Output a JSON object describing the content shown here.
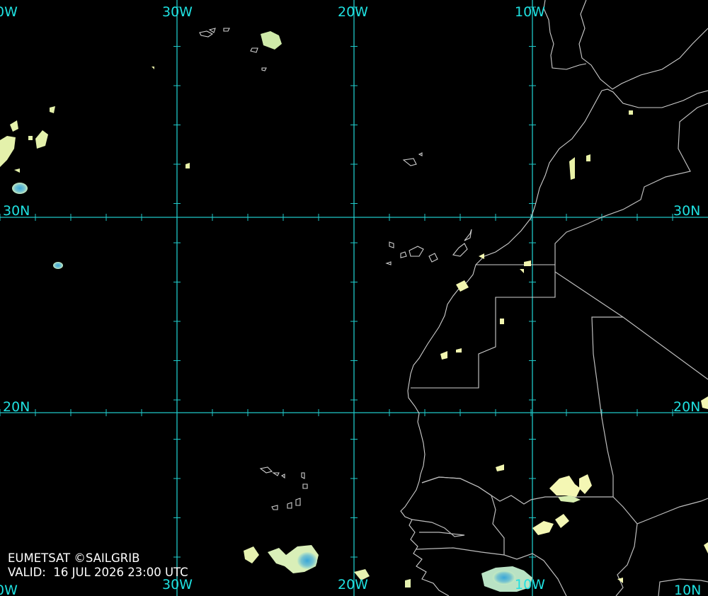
{
  "map": {
    "longitude_labels": {
      "top": [
        "0W",
        "30W",
        "20W",
        "10W"
      ],
      "bottom": [
        "0W",
        "30W",
        "20W",
        "10W",
        "10N"
      ]
    },
    "latitude_labels": {
      "left": [
        "30N",
        "20N"
      ],
      "right": [
        "30N",
        "20N"
      ]
    },
    "colors": {
      "grid": "#1fc7c7",
      "label": "#1fe0e0",
      "coastline": "#cfcfcf",
      "background": "#000000",
      "cloud_low": "#f4f7b4",
      "cloud_mid": "#a9dcc2",
      "cloud_high": "#3aa7d8"
    }
  },
  "credit": {
    "source": "EUMETSAT ©SAILGRIB",
    "valid": "VALID:  16 JUL 2026 23:00 UTC"
  }
}
